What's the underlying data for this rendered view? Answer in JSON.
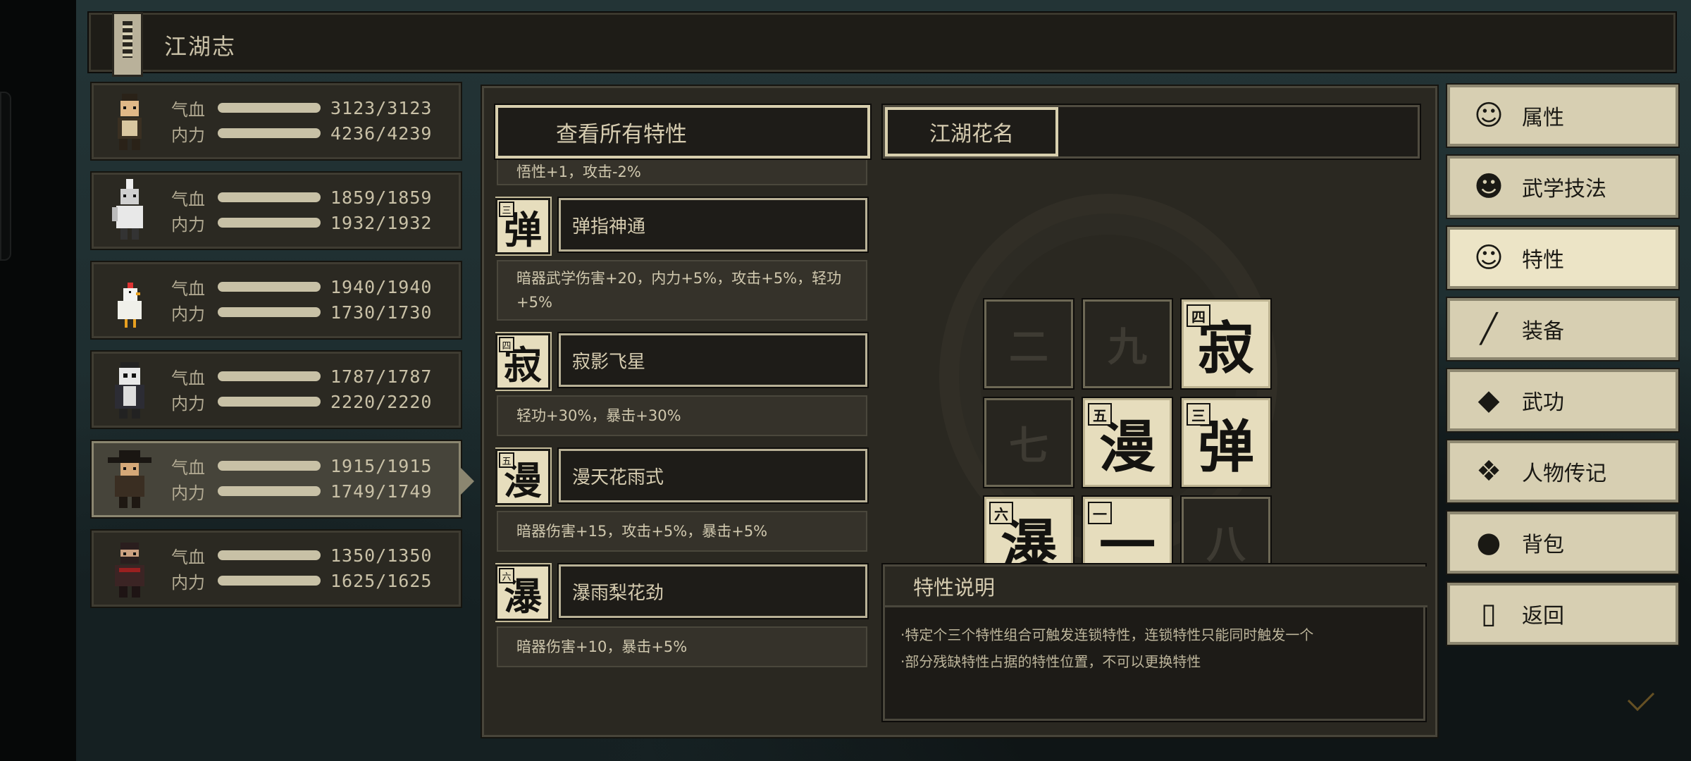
{
  "header": {
    "title": "江湖志",
    "icon": "book-icon"
  },
  "party": [
    {
      "hp_label": "气血",
      "hp": "3123/3123",
      "mp_label": "内力",
      "mp": "4236/4239",
      "selected": false
    },
    {
      "hp_label": "气血",
      "hp": "1859/1859",
      "mp_label": "内力",
      "mp": "1932/1932",
      "selected": false
    },
    {
      "hp_label": "气血",
      "hp": "1940/1940",
      "mp_label": "内力",
      "mp": "1730/1730",
      "selected": false
    },
    {
      "hp_label": "气血",
      "hp": "1787/1787",
      "mp_label": "内力",
      "mp": "2220/2220",
      "selected": false
    },
    {
      "hp_label": "气血",
      "hp": "1915/1915",
      "mp_label": "内力",
      "mp": "1749/1749",
      "selected": true
    },
    {
      "hp_label": "气血",
      "hp": "1350/1350",
      "mp_label": "内力",
      "mp": "1625/1625",
      "selected": false
    }
  ],
  "traits": {
    "view_all_label": "查看所有特性",
    "cut_desc": "悟性+1，攻击-2%",
    "items": [
      {
        "glyph": "弹",
        "num": "三",
        "name": "弹指神通",
        "desc": "暗器武学伤害+20，内力+5%，攻击+5%，轻功+5%"
      },
      {
        "glyph": "寂",
        "num": "四",
        "name": "寂影飞星",
        "desc": "轻功+30%，暴击+30%"
      },
      {
        "glyph": "漫",
        "num": "五",
        "name": "漫天花雨式",
        "desc": "暗器伤害+15，攻击+5%，暴击+5%"
      },
      {
        "glyph": "瀑",
        "num": "六",
        "name": "瀑雨梨花劲",
        "desc": "暗器伤害+10，暴击+5%"
      }
    ]
  },
  "combo": {
    "tab_label": "江湖花名",
    "cells": [
      {
        "glyph": "二",
        "num": "",
        "filled": false
      },
      {
        "glyph": "九",
        "num": "",
        "filled": false
      },
      {
        "glyph": "寂",
        "num": "四",
        "filled": true
      },
      {
        "glyph": "七",
        "num": "",
        "filled": false
      },
      {
        "glyph": "漫",
        "num": "五",
        "filled": true
      },
      {
        "glyph": "弹",
        "num": "三",
        "filled": true
      },
      {
        "glyph": "瀑",
        "num": "六",
        "filled": true
      },
      {
        "glyph": "一",
        "num": "一",
        "filled": true
      },
      {
        "glyph": "八",
        "num": "",
        "filled": false
      }
    ]
  },
  "description": {
    "title": "特性说明",
    "lines": [
      "·特定个三个特性组合可触发连锁特性，连锁特性只能同时触发一个",
      "·部分残缺特性占据的特性位置，不可以更换特性"
    ]
  },
  "menu": [
    {
      "label": "属性",
      "icon": "character-icon",
      "active": false
    },
    {
      "label": "武学技法",
      "icon": "martial-skill-icon",
      "active": false
    },
    {
      "label": "特性",
      "icon": "trait-icon",
      "active": true
    },
    {
      "label": "装备",
      "icon": "sword-icon",
      "active": false
    },
    {
      "label": "武功",
      "icon": "manual-book-icon",
      "active": false
    },
    {
      "label": "人物传记",
      "icon": "scroll-icon",
      "active": false
    },
    {
      "label": "背包",
      "icon": "bag-icon",
      "active": false
    },
    {
      "label": "返回",
      "icon": "door-icon",
      "active": false
    }
  ]
}
